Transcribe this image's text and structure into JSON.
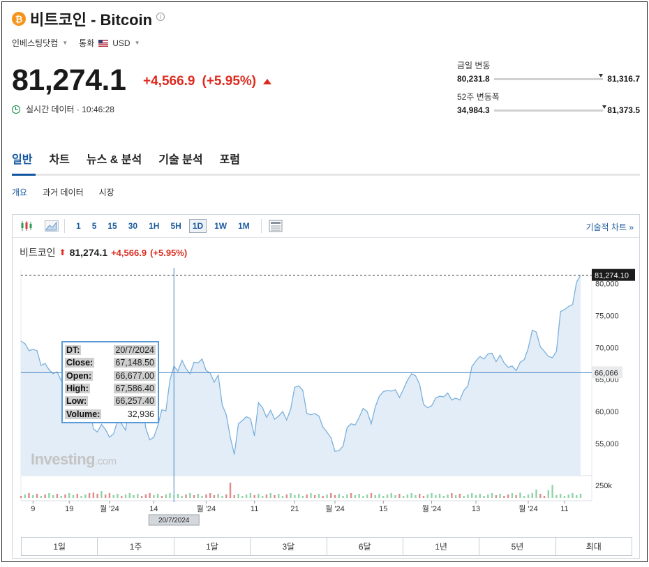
{
  "header": {
    "coin_symbol": "₿",
    "title": "비트코인 - Bitcoin",
    "info_icon": "info-icon"
  },
  "meta": {
    "source_label": "인베스팅닷컴",
    "currency_label": "통화",
    "currency_value": "USD"
  },
  "quote": {
    "price": "81,274.1",
    "change": "+4,566.9",
    "change_pct": "(+5.95%)",
    "realtime_label": "실시간 데이터 · 10:46:28"
  },
  "ranges": {
    "day": {
      "label": "금일 변동",
      "low": "80,231.8",
      "high": "81,316.7",
      "position": 0.96
    },
    "week52": {
      "label": "52주 변동폭",
      "low": "34,984.3",
      "high": "81,373.5",
      "position": 0.99
    }
  },
  "tabs": [
    "일반",
    "차트",
    "뉴스 & 분석",
    "기술 분석",
    "포럼"
  ],
  "subtabs": [
    "개요",
    "과거 데이터",
    "시장"
  ],
  "toolbar": {
    "intervals": [
      "1",
      "5",
      "15",
      "30",
      "1H",
      "5H",
      "1D",
      "1W",
      "1M"
    ],
    "active_interval": "1D",
    "tech_link": "기술적 차트 »"
  },
  "legend": {
    "name": "비트코인",
    "price": "81,274.1",
    "change": "+4,566.9",
    "change_pct": "(+5.95%)"
  },
  "tooltip": {
    "rows": [
      {
        "key": "DT:",
        "value": "20/7/2024"
      },
      {
        "key": "Close:",
        "value": "67,148.50"
      },
      {
        "key": "Open:",
        "value": "66,677.00"
      },
      {
        "key": "High:",
        "value": "67,586.40"
      },
      {
        "key": "Low:",
        "value": "66,257.40"
      },
      {
        "key": "Volume:",
        "value": "32,936"
      }
    ]
  },
  "watermark": {
    "main": "Investing",
    "suffix": ".com"
  },
  "periods": [
    "1일",
    "1주",
    "1달",
    "3달",
    "6달",
    "1년",
    "5년",
    "최대"
  ],
  "colors": {
    "accent": "#1256a0",
    "down_red": "#dd2b1f",
    "line": "#7ab0dd",
    "area": "#e3edf7",
    "bitcoin": "#f7931a"
  },
  "chart_data": {
    "type": "area",
    "ylim": [
      50000,
      82000
    ],
    "y_ticks": [
      80000,
      75000,
      70000,
      65000,
      60000,
      55000
    ],
    "y_tick_labels": [
      "80,000",
      "75,000",
      "70,000",
      "65,000",
      "60,000",
      "55,000"
    ],
    "last_price_label": "81,274.10",
    "crosshair_price_label": "66,066",
    "crosshair_price": 66066,
    "crosshair_date_label": "20/7/2024",
    "crosshair_index": 38,
    "volume_label": "250k",
    "x_tick_labels": [
      "9",
      "19",
      "월 '24",
      "14",
      "월 '24",
      "11",
      "21",
      "월 '24",
      "15",
      "월 '24",
      "13",
      "월 '24",
      "11"
    ],
    "x_tick_index": [
      3,
      12,
      22,
      33,
      46,
      58,
      68,
      78,
      90,
      102,
      113,
      126,
      135
    ],
    "close": [
      71000,
      70600,
      69500,
      69700,
      69500,
      67200,
      67500,
      66500,
      65900,
      66200,
      64800,
      65500,
      63500,
      63000,
      61200,
      61600,
      61700,
      60800,
      57300,
      56800,
      58000,
      57200,
      56000,
      56500,
      58600,
      58100,
      57100,
      62100,
      64500,
      64400,
      62100,
      57400,
      55600,
      56000,
      57800,
      60300,
      60100,
      64900,
      67100,
      66300,
      68000,
      66700,
      65900,
      67700,
      67600,
      68200,
      66400,
      66000,
      64600,
      65700,
      61000,
      59500,
      56000,
      53300,
      58100,
      58600,
      59200,
      58900,
      56200,
      61400,
      60600,
      59100,
      60200,
      58800,
      59300,
      60000,
      58700,
      60400,
      63800,
      64000,
      63300,
      59700,
      59500,
      59700,
      59300,
      57600,
      56800,
      55900,
      53800,
      53900,
      54600,
      57500,
      58100,
      57900,
      59100,
      60500,
      60000,
      58100,
      60700,
      62400,
      63100,
      63300,
      63200,
      63400,
      62200,
      63500,
      64900,
      65900,
      65600,
      64300,
      61100,
      60600,
      60900,
      62100,
      62400,
      62300,
      62900,
      61800,
      62100,
      61800,
      63300,
      64000,
      67000,
      67900,
      68600,
      68200,
      69000,
      69100,
      67800,
      68800,
      67600,
      66900,
      67100,
      66400,
      67700,
      68100,
      69900,
      72700,
      72400,
      70100,
      69400,
      68600,
      68400,
      69400,
      75600,
      75900,
      76400,
      76700,
      80200,
      81274
    ],
    "volume_red": [
      0,
      2,
      4,
      6,
      9,
      11,
      14,
      17,
      18,
      19,
      21,
      22,
      25,
      30,
      31,
      32,
      35,
      41,
      43,
      46,
      47,
      48,
      51,
      52,
      53,
      58,
      61,
      63,
      66,
      71,
      73,
      75,
      77,
      78,
      82,
      87,
      94,
      99,
      100,
      107,
      109,
      118,
      120,
      121,
      123,
      129,
      130
    ],
    "volume_spikes": {
      "52": 1.0,
      "20": 0.45,
      "18": 0.35,
      "132": 0.85,
      "128": 0.55,
      "131": 0.5,
      "124": 0.35
    }
  }
}
